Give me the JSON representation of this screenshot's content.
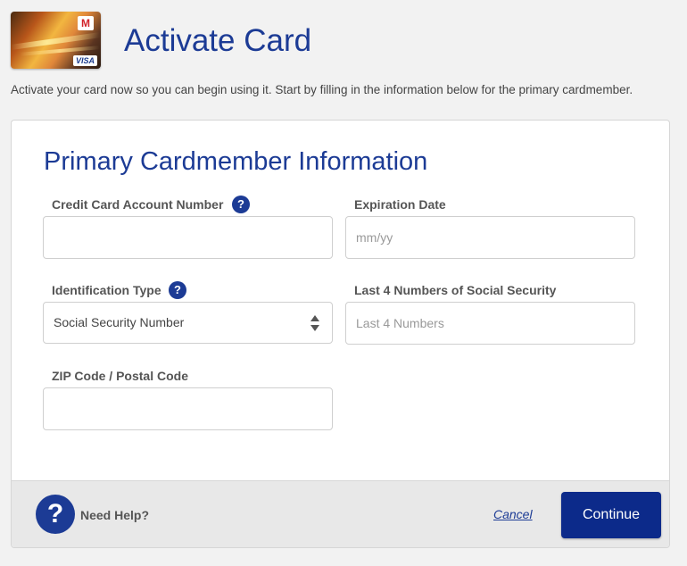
{
  "header": {
    "title": "Activate Card",
    "card_logo_letter": "M",
    "card_brand": "VISA",
    "intro": "Activate your card now so you can begin using it. Start by filling in the information below for the primary cardmember."
  },
  "form": {
    "section_title": "Primary Cardmember Information",
    "fields": {
      "account_number": {
        "label": "Credit Card Account Number",
        "value": "",
        "placeholder": ""
      },
      "expiration": {
        "label": "Expiration Date",
        "value": "",
        "placeholder": "mm/yy"
      },
      "id_type": {
        "label": "Identification Type",
        "selected": "Social Security Number"
      },
      "ssn_last4": {
        "label": "Last 4 Numbers of Social Security",
        "value": "",
        "placeholder": "Last 4 Numbers"
      },
      "zip": {
        "label": "ZIP Code / Postal Code",
        "value": "",
        "placeholder": ""
      }
    },
    "help_glyph": "?"
  },
  "footer": {
    "help_glyph": "?",
    "need_help": "Need Help?",
    "cancel": "Cancel",
    "continue": "Continue"
  },
  "colors": {
    "brand_blue": "#1c3b95",
    "button_blue": "#0c2a8a",
    "background": "#f2f2f2"
  }
}
